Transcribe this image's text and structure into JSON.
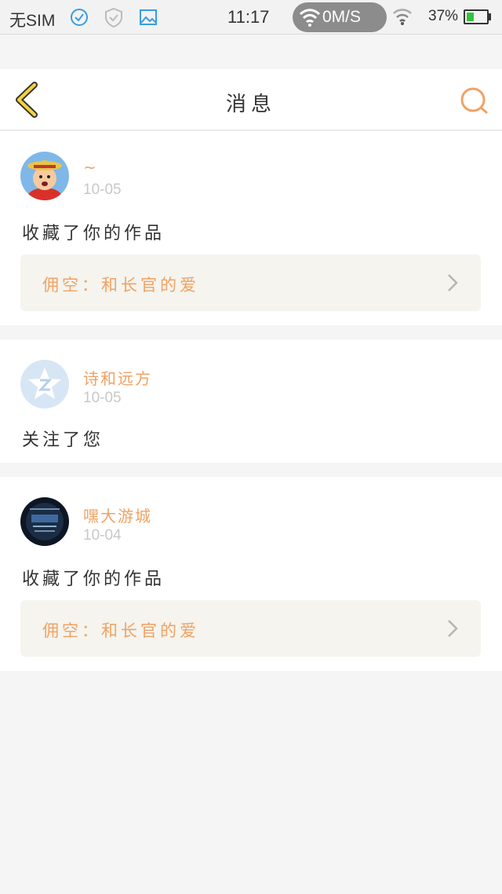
{
  "status_bar": {
    "sim": "无SIM",
    "time": "11:17",
    "net_speed": "0M/S",
    "battery": "37%",
    "battery_level": 0.37
  },
  "header": {
    "title": "消息"
  },
  "colors": {
    "accent": "#f0a264",
    "back_arrow": "#f5d33a",
    "work_bg": "#f5f4ee"
  },
  "messages": [
    {
      "user": "~",
      "date": "10-05",
      "action": "收藏了你的作品",
      "work": "佣空：和长官的爱",
      "avatar": "cartoon-avatar"
    },
    {
      "user": "诗和远方",
      "date": "10-05",
      "action": "关注了您",
      "avatar": "default-qzone-avatar"
    },
    {
      "user": "嘿大游城",
      "date": "10-04",
      "action": "收藏了你的作品",
      "work": "佣空：和长官的爱",
      "avatar": "game-avatar"
    }
  ]
}
